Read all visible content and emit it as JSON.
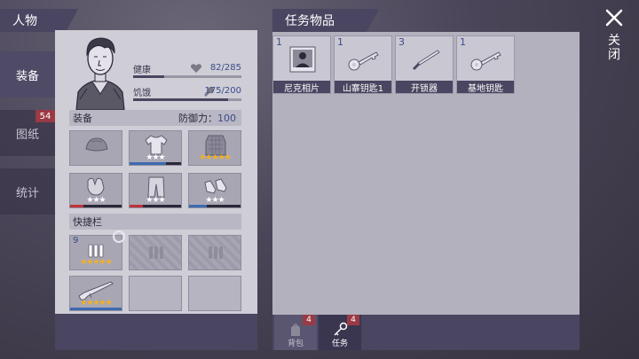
{
  "left_header": "人物",
  "right_header": "任务物品",
  "tabs": [
    {
      "label": "装备",
      "active": true
    },
    {
      "label": "图纸",
      "badge": "54"
    },
    {
      "label": "统计"
    }
  ],
  "stats": {
    "health_label": "健康",
    "health_value": "82/285",
    "health_fraction": 0.29,
    "hunger_label": "饥饿",
    "hunger_value": "175/200",
    "hunger_fraction": 0.875
  },
  "equipment": {
    "title": "装备",
    "defense_label": "防御力：",
    "defense_value": "100",
    "slots": [
      {
        "icon": "cap-icon",
        "stars": 0
      },
      {
        "icon": "shirt-icon",
        "stars": 3,
        "star_color": "white"
      },
      {
        "icon": "armor-vest-icon",
        "stars": 5,
        "star_color": "gold"
      },
      {
        "icon": "gloves-icon",
        "stars": 3,
        "star_color": "white"
      },
      {
        "icon": "pants-icon",
        "stars": 3,
        "star_color": "white"
      },
      {
        "icon": "shoes-icon",
        "stars": 3,
        "star_color": "white"
      }
    ]
  },
  "quickbar": {
    "title": "快捷栏",
    "slots": [
      {
        "icon": "ammo-icon",
        "qty": "9",
        "stars": 5
      },
      {
        "icon": "locked-ammo-icon"
      },
      {
        "icon": "locked-ammo-icon"
      },
      {
        "icon": "shotgun-icon",
        "stars": 5
      },
      {
        "icon": "empty"
      },
      {
        "icon": "empty"
      }
    ]
  },
  "task_items": [
    {
      "qty": "1",
      "name": "尼克相片",
      "icon": "photo-icon"
    },
    {
      "qty": "1",
      "name": "山寨钥匙1",
      "icon": "key-icon"
    },
    {
      "qty": "3",
      "name": "开锁器",
      "icon": "lockpick-icon"
    },
    {
      "qty": "1",
      "name": "基地钥匙",
      "icon": "key-icon"
    }
  ],
  "bottom_tabs": [
    {
      "label": "背包",
      "badge": "4"
    },
    {
      "label": "任务",
      "badge": "4",
      "active": true
    }
  ],
  "close_label": "关闭",
  "colors": {
    "panel_dark": "#4a4560",
    "badge_red": "#9a3a45",
    "star_gold": "#f4b21b",
    "value_blue": "#3a4c8a"
  }
}
